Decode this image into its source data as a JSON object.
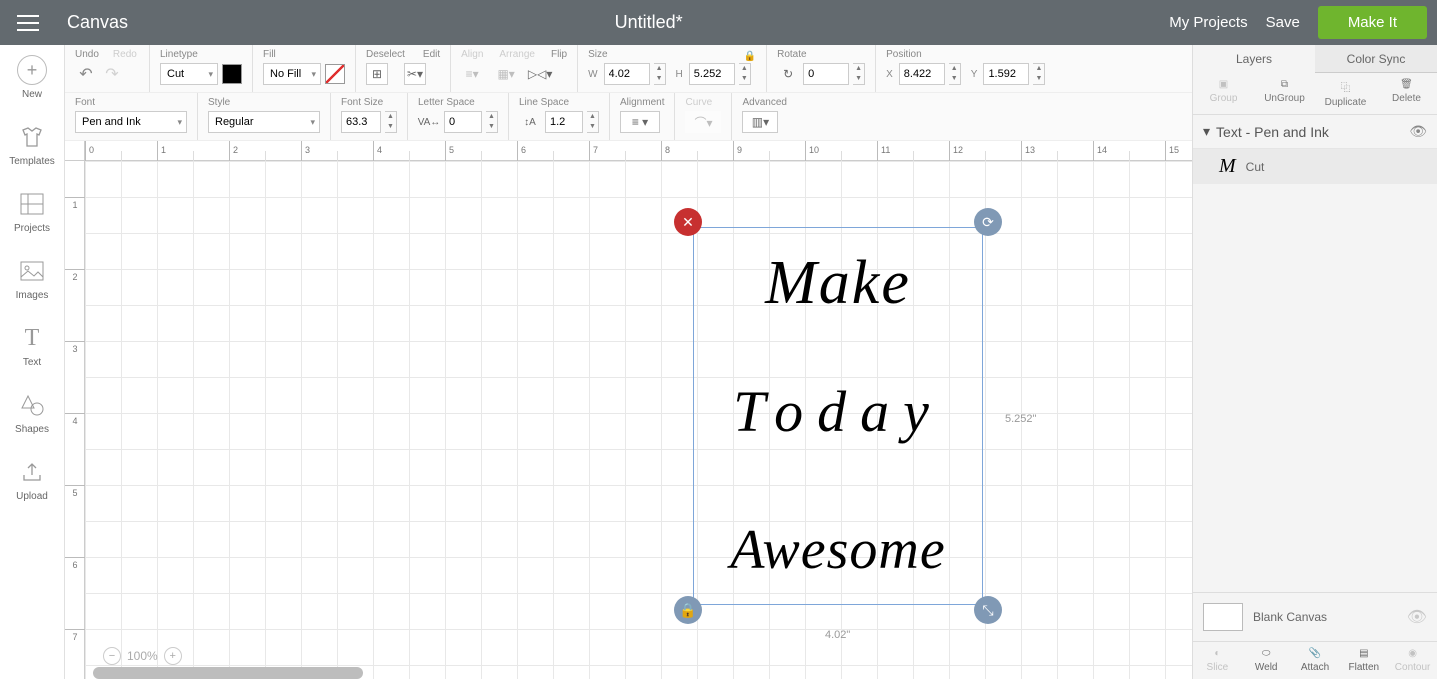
{
  "header": {
    "app": "Canvas",
    "doc": "Untitled*",
    "my_projects": "My Projects",
    "save": "Save",
    "make_it": "Make It"
  },
  "sidebar": [
    {
      "label": "New"
    },
    {
      "label": "Templates"
    },
    {
      "label": "Projects"
    },
    {
      "label": "Images"
    },
    {
      "label": "Text"
    },
    {
      "label": "Shapes"
    },
    {
      "label": "Upload"
    }
  ],
  "toolbar1": {
    "undo": "Undo",
    "redo": "Redo",
    "linetype": {
      "label": "Linetype",
      "value": "Cut"
    },
    "fill": {
      "label": "Fill",
      "value": "No Fill"
    },
    "deselect": "Deselect",
    "edit": "Edit",
    "align": "Align",
    "arrange": "Arrange",
    "flip": "Flip",
    "size": {
      "label": "Size",
      "w": "4.02",
      "h": "5.252"
    },
    "rotate": {
      "label": "Rotate",
      "value": "0"
    },
    "position": {
      "label": "Position",
      "x": "8.422",
      "y": "1.592"
    }
  },
  "toolbar2": {
    "font": {
      "label": "Font",
      "value": "Pen and Ink"
    },
    "style": {
      "label": "Style",
      "value": "Regular"
    },
    "fontsize": {
      "label": "Font Size",
      "value": "63.3"
    },
    "letterspace": {
      "label": "Letter Space",
      "value": "0"
    },
    "linespace": {
      "label": "Line Space",
      "value": "1.2"
    },
    "alignment": "Alignment",
    "curve": "Curve",
    "advanced": "Advanced"
  },
  "canvas": {
    "text_lines": [
      "Make",
      "Today",
      "Awesome"
    ],
    "sel_w": "4.02\"",
    "sel_h": "5.252\"",
    "zoom": "100%"
  },
  "right": {
    "tabs": {
      "layers": "Layers",
      "color_sync": "Color Sync"
    },
    "actions": {
      "group": "Group",
      "ungroup": "UnGroup",
      "duplicate": "Duplicate",
      "delete": "Delete"
    },
    "layer_header": "Text - Pen and Ink",
    "layer_item": "Cut",
    "blank": "Blank Canvas",
    "bottom": {
      "slice": "Slice",
      "weld": "Weld",
      "attach": "Attach",
      "flatten": "Flatten",
      "contour": "Contour"
    }
  }
}
